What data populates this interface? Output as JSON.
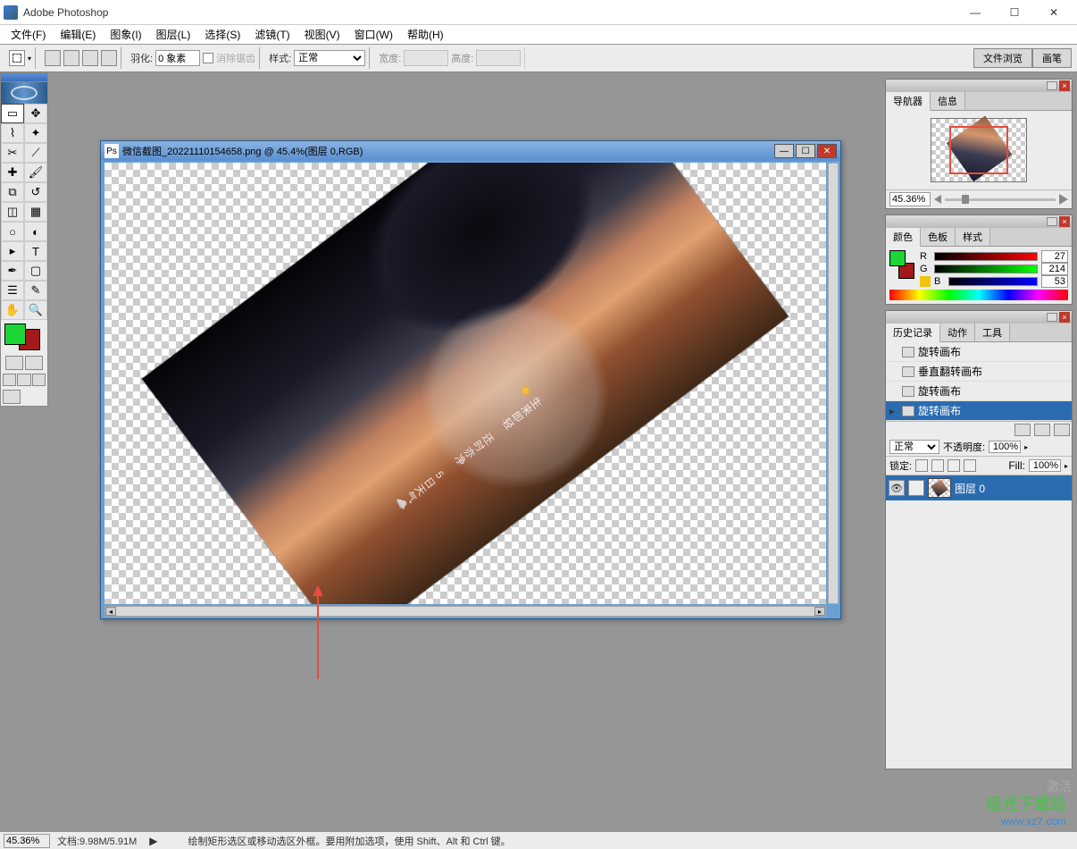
{
  "app": {
    "title": "Adobe Photoshop"
  },
  "menubar": {
    "file": "文件(F)",
    "edit": "编辑(E)",
    "image": "图象(I)",
    "layer": "图层(L)",
    "select": "选择(S)",
    "filter": "滤镜(T)",
    "view": "视图(V)",
    "window": "窗口(W)",
    "help": "帮助(H)"
  },
  "options": {
    "feather_label": "羽化:",
    "feather_value": "0 象素",
    "antialias_label": "消除锯齿",
    "style_label": "样式:",
    "style_value": "正常",
    "width_label": "宽度:",
    "height_label": "高度:",
    "tab_browse": "文件浏览",
    "tab_brush": "画笔"
  },
  "document": {
    "title": "微信截图_20221110154658.png @ 45.4%(图层 0,RGB)",
    "overlay_text": "生来即轻 还时亦净\n5日天气☁️☀️"
  },
  "navigator": {
    "tab_nav": "导航器",
    "tab_info": "信息",
    "zoom_value": "45.36%"
  },
  "color": {
    "tab_color": "颜色",
    "tab_swatches": "色板",
    "tab_styles": "样式",
    "r_label": "R",
    "r_value": "27",
    "g_label": "G",
    "g_value": "214",
    "b_label": "B",
    "b_value": "53"
  },
  "history": {
    "tab_history": "历史记录",
    "tab_actions": "动作",
    "tab_tools": "工具",
    "items": [
      "旋转画布",
      "垂直翻转画布",
      "旋转画布",
      "旋转画布"
    ]
  },
  "layers": {
    "blend_mode": "正常",
    "opacity_label": "不透明度:",
    "opacity_value": "100%",
    "lock_label": "锁定:",
    "fill_label": "Fill:",
    "fill_value": "100%",
    "layer0": "图层 0"
  },
  "statusbar": {
    "zoom": "45.36%",
    "doc_size": "文档:9.98M/5.91M",
    "hint": "绘制矩形选区或移动选区外框。要用附加选项，使用 Shift、Alt 和 Ctrl 键。"
  },
  "watermark": {
    "brand": "极光下载站",
    "url": "www.xz7.com"
  },
  "activate": "激活"
}
